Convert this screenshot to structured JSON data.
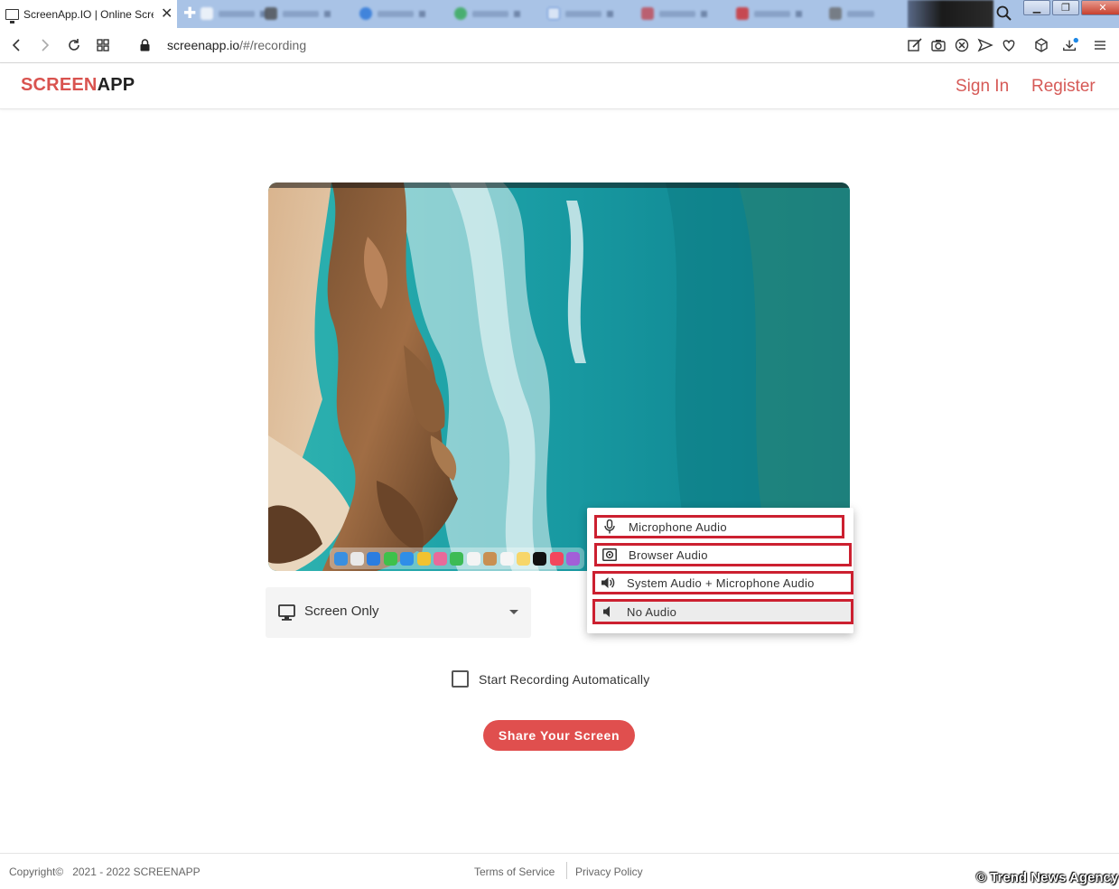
{
  "browser": {
    "active_tab_title": "ScreenApp.IO | Online Scre",
    "url_host": "screenapp.io",
    "url_path": "/#/recording"
  },
  "header": {
    "logo_part1": "SCREEN",
    "logo_part2": "APP",
    "sign_in": "Sign In",
    "register": "Register"
  },
  "controls": {
    "screen_mode": "Screen Only",
    "audio_options": [
      {
        "label": "Microphone Audio",
        "icon": "microphone-icon"
      },
      {
        "label": "Browser Audio",
        "icon": "browser-audio-icon"
      },
      {
        "label": "System Audio + Microphone Audio",
        "icon": "speaker-icon"
      },
      {
        "label": "No Audio",
        "icon": "speaker-mute-icon"
      }
    ],
    "selected_audio": "No Audio",
    "auto_record_label": "Start Recording Automatically",
    "auto_record_checked": false,
    "share_button": "Share Your Screen"
  },
  "footer": {
    "copyright": "Copyright©   2021 - 2022 SCREENAPP",
    "terms": "Terms of Service",
    "privacy": "Privacy Policy",
    "watermark": "© Trend News Agency"
  },
  "colors": {
    "brand_red": "#d9534f",
    "button_red": "#e04f4e",
    "highlight_red": "#cc2030"
  }
}
